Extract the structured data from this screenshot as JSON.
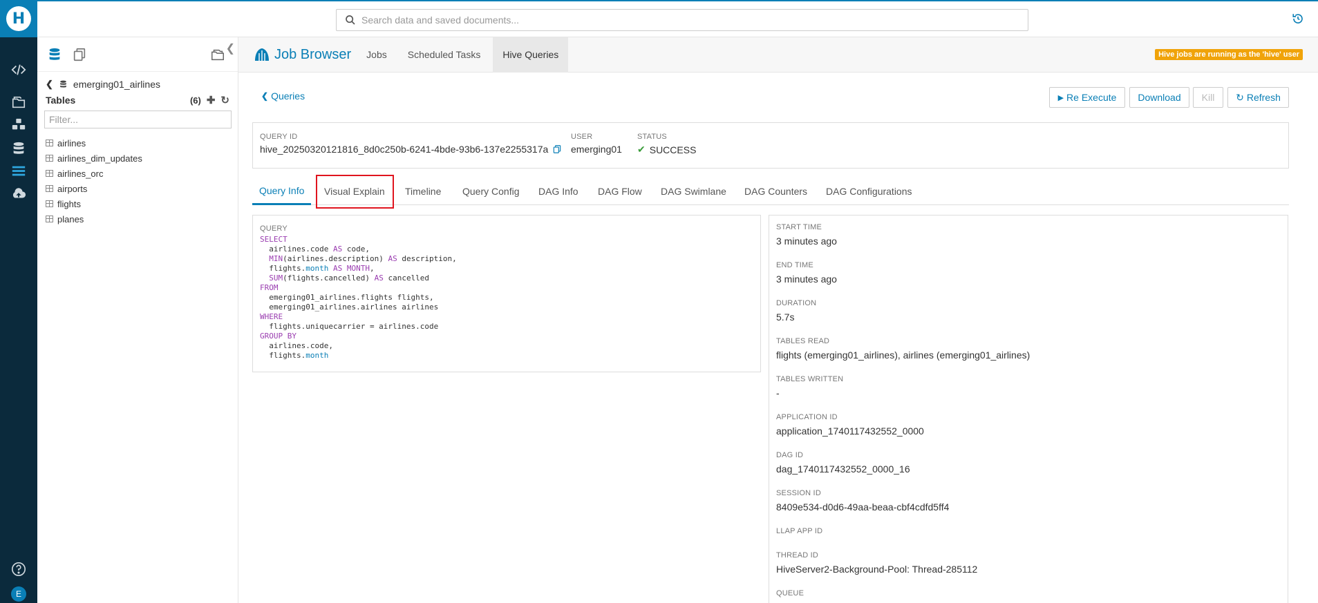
{
  "search": {
    "placeholder": "Search data and saved documents..."
  },
  "rail": {
    "logo": "H",
    "items": [
      "editor-icon",
      "documents-icon",
      "jobs-icon",
      "tables-icon",
      "job-browser-icon",
      "importer-icon"
    ],
    "help": "help-icon",
    "avatar": "E"
  },
  "assist": {
    "database": "emerging01_airlines",
    "tables_label": "Tables",
    "tables_count": "(6)",
    "filter_placeholder": "Filter...",
    "tables": [
      "airlines",
      "airlines_dim_updates",
      "airlines_orc",
      "airports",
      "flights",
      "planes"
    ]
  },
  "header": {
    "title": "Job Browser",
    "tabs": [
      "Jobs",
      "Scheduled Tasks",
      "Hive Queries"
    ],
    "active_tab": "Hive Queries",
    "notice": "Hive jobs are running as the 'hive' user"
  },
  "actions": {
    "back": "Queries",
    "re_execute": "Re Execute",
    "download": "Download",
    "kill": "Kill",
    "refresh": "Refresh"
  },
  "query_info": {
    "query_id_label": "QUERY ID",
    "query_id": "hive_20250320121816_8d0c250b-6241-4bde-93b6-137e2255317a",
    "user_label": "USER",
    "user": "emerging01",
    "status_label": "STATUS",
    "status": "SUCCESS"
  },
  "subtabs": [
    "Query Info",
    "Visual Explain",
    "Timeline",
    "Query Config",
    "DAG Info",
    "DAG Flow",
    "DAG Swimlane",
    "DAG Counters",
    "DAG Configurations"
  ],
  "query_panel": {
    "label": "QUERY"
  },
  "details": [
    {
      "label": "START TIME",
      "value": "3 minutes ago"
    },
    {
      "label": "END TIME",
      "value": "3 minutes ago"
    },
    {
      "label": "DURATION",
      "value": "5.7s"
    },
    {
      "label": "TABLES READ",
      "value": "flights (emerging01_airlines), airlines (emerging01_airlines)"
    },
    {
      "label": "TABLES WRITTEN",
      "value": "-"
    },
    {
      "label": "APPLICATION ID",
      "value": "application_1740117432552_0000"
    },
    {
      "label": "DAG ID",
      "value": "dag_1740117432552_0000_16"
    },
    {
      "label": "SESSION ID",
      "value": "8409e534-d0d6-49aa-beaa-cbf4cdfd5ff4"
    },
    {
      "label": "LLAP APP ID",
      "value": ""
    },
    {
      "label": "THREAD ID",
      "value": "HiveServer2-Background-Pool: Thread-285112"
    },
    {
      "label": "QUEUE",
      "value": ""
    }
  ],
  "colors": {
    "accent": "#0a7fb6",
    "rail": "#0b2a3c",
    "notice": "#f0a30a",
    "highlight": "#e0141e",
    "success": "#3a9c3a"
  }
}
